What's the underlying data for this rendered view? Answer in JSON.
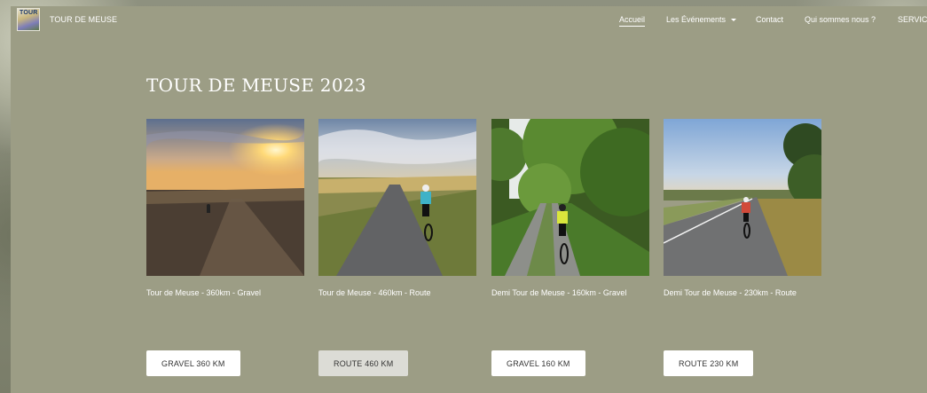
{
  "header": {
    "logo_text": "TOUR",
    "brand": "TOUR DE MEUSE"
  },
  "nav": {
    "items": [
      {
        "label": "Accueil",
        "active": true
      },
      {
        "label": "Les Événements",
        "dropdown": true
      },
      {
        "label": "Contact"
      },
      {
        "label": "Qui sommes nous ?"
      },
      {
        "label": "SERVICES"
      }
    ]
  },
  "main": {
    "title": "TOUR DE MEUSE 2023",
    "cards": [
      {
        "caption": "Tour de Meuse - 360km - Gravel",
        "button": "GRAVEL 360 KM",
        "image": "sunset-gravel-photo"
      },
      {
        "caption": "Tour de Meuse - 460km - Route",
        "button": "ROUTE 460 KM",
        "image": "road-cyclist-photo",
        "active": true
      },
      {
        "caption": "Demi Tour de Meuse - 160km - Gravel",
        "button": "GRAVEL 160 KM",
        "image": "forest-path-photo"
      },
      {
        "caption": "Demi Tour de Meuse - 230km - Route",
        "button": "ROUTE 230 KM",
        "image": "countryside-road-photo"
      }
    ]
  },
  "colors": {
    "panel": "#9c9d85",
    "text": "#ffffff",
    "button_bg": "#ffffff",
    "button_active_bg": "#dcdcd6"
  }
}
